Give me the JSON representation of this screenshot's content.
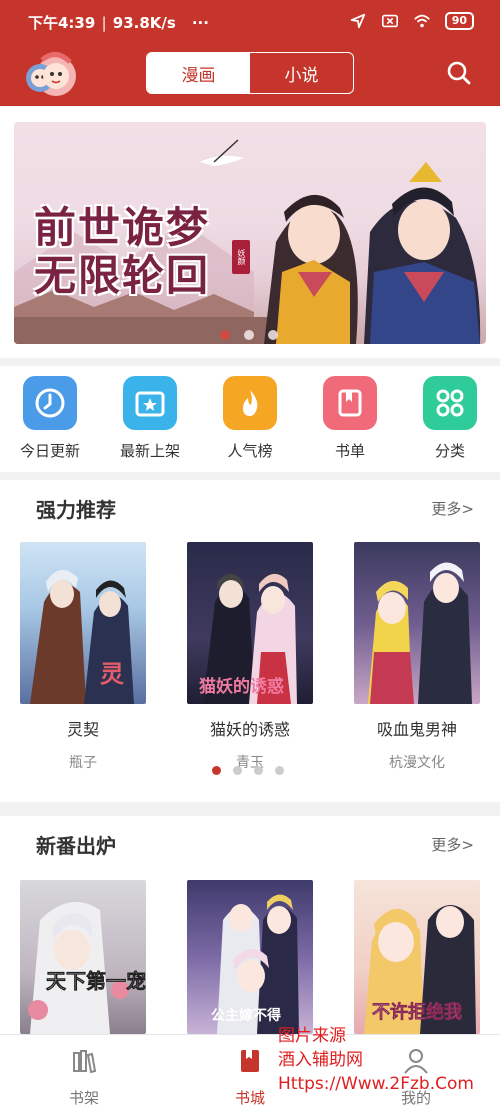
{
  "status_bar": {
    "time": "下午4:39",
    "speed": "93.8K/s",
    "more": "···",
    "battery": "90"
  },
  "header": {
    "tabs": [
      {
        "label": "漫画",
        "active": true
      },
      {
        "label": "小说",
        "active": false
      }
    ],
    "icons": [
      "app-logo",
      "search-icon"
    ]
  },
  "banner": {
    "title_line1": "前世诡梦",
    "title_line2": "无限轮回",
    "stamp": "妖颜",
    "slide_count": 3,
    "active_slide": 0
  },
  "quick_nav": [
    {
      "label": "今日更新",
      "icon": "clock-icon",
      "color": "#4a9be8"
    },
    {
      "label": "最新上架",
      "icon": "new-shelf-icon",
      "color": "#3ab3ea"
    },
    {
      "label": "人气榜",
      "icon": "flame-icon",
      "color": "#f5a623"
    },
    {
      "label": "书单",
      "icon": "book-icon",
      "color": "#f06a7a"
    },
    {
      "label": "分类",
      "icon": "category-icon",
      "color": "#2fcc9a"
    }
  ],
  "recommend": {
    "title": "强力推荐",
    "more": "更多>",
    "items": [
      {
        "title": "灵契",
        "author": "瓶子"
      },
      {
        "title": "猫妖的诱惑",
        "author": "青玉"
      },
      {
        "title": "吸血鬼男神",
        "author": "杭漫文化"
      }
    ],
    "page_count": 4,
    "active_page": 0
  },
  "new_release": {
    "title": "新番出炉",
    "more": "更多>",
    "cover_texts": [
      "天下第一宠",
      "公主嫁不得",
      "不许拒绝我"
    ]
  },
  "tabbar": [
    {
      "label": "书架",
      "icon": "bookshelf-icon",
      "active": false
    },
    {
      "label": "书城",
      "icon": "bookstore-icon",
      "active": true
    },
    {
      "label": "我的",
      "icon": "profile-icon",
      "active": false
    }
  ],
  "watermark": {
    "line1": "图片来源",
    "line2": "酒入辅助网",
    "line3": "Https://Www.2Fzb.Com"
  },
  "colors": {
    "brand": "#c6352b",
    "background": "#f2f2f2"
  }
}
